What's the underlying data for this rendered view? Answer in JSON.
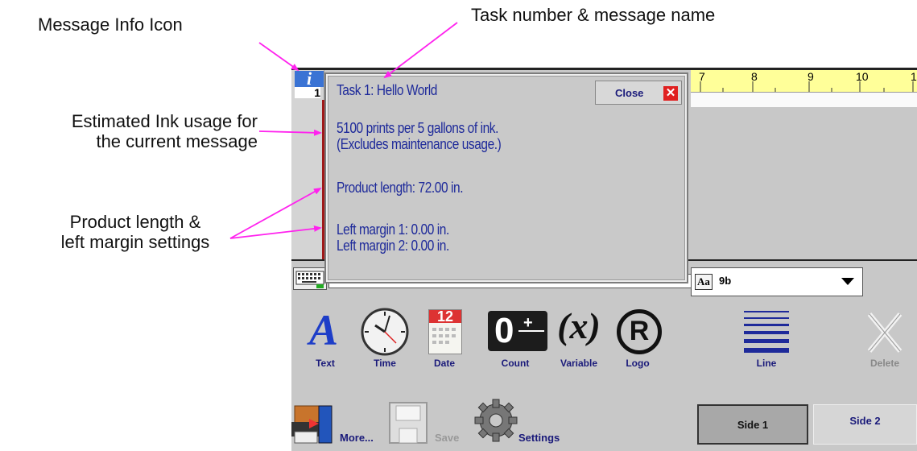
{
  "callouts": {
    "message_info_icon": "Message Info Icon",
    "task_name": "Task number & message name",
    "ink_usage": [
      "Estimated Ink usage for",
      "the current message"
    ],
    "product_length": [
      "Product length &",
      "left margin settings"
    ]
  },
  "info_button": {
    "icon": "info-icon",
    "task_number": "1"
  },
  "popup": {
    "title": "Task 1: Hello World",
    "close_label": "Close",
    "ink_line1": "5100 prints per 5 gallons of ink.",
    "ink_line2": "(Excludes maintenance usage.)",
    "product_length": "Product length: 72.00 in.",
    "left_margin1": "Left margin 1: 0.00 in.",
    "left_margin2": "Left margin 2: 0.00 in."
  },
  "ruler": {
    "ticks": [
      "7",
      "8",
      "9",
      "10",
      "1"
    ]
  },
  "font_select": {
    "icon_text": "Aa",
    "value": "9b"
  },
  "tools": [
    {
      "label": "Text",
      "icon": "text-icon"
    },
    {
      "label": "Time",
      "icon": "clock-icon"
    },
    {
      "label": "Date",
      "icon": "calendar-icon",
      "day": "12"
    },
    {
      "label": "Count",
      "icon": "counter-icon",
      "digits": "0"
    },
    {
      "label": "Variable",
      "icon": "variable-icon",
      "symbol": "(x)"
    },
    {
      "label": "Logo",
      "icon": "registered-icon",
      "symbol": "R"
    },
    {
      "label": "Line",
      "icon": "lines-icon"
    },
    {
      "label": "Delete",
      "icon": "delete-icon"
    }
  ],
  "bottom": {
    "more": "More...",
    "save": "Save",
    "settings": "Settings",
    "side1": "Side 1",
    "side2": "Side 2"
  },
  "colors": {
    "arrow": "#ff22ee",
    "text_blue": "#1e2a9a",
    "ruler_yellow": "#ffff99",
    "close_red": "#e02020"
  }
}
